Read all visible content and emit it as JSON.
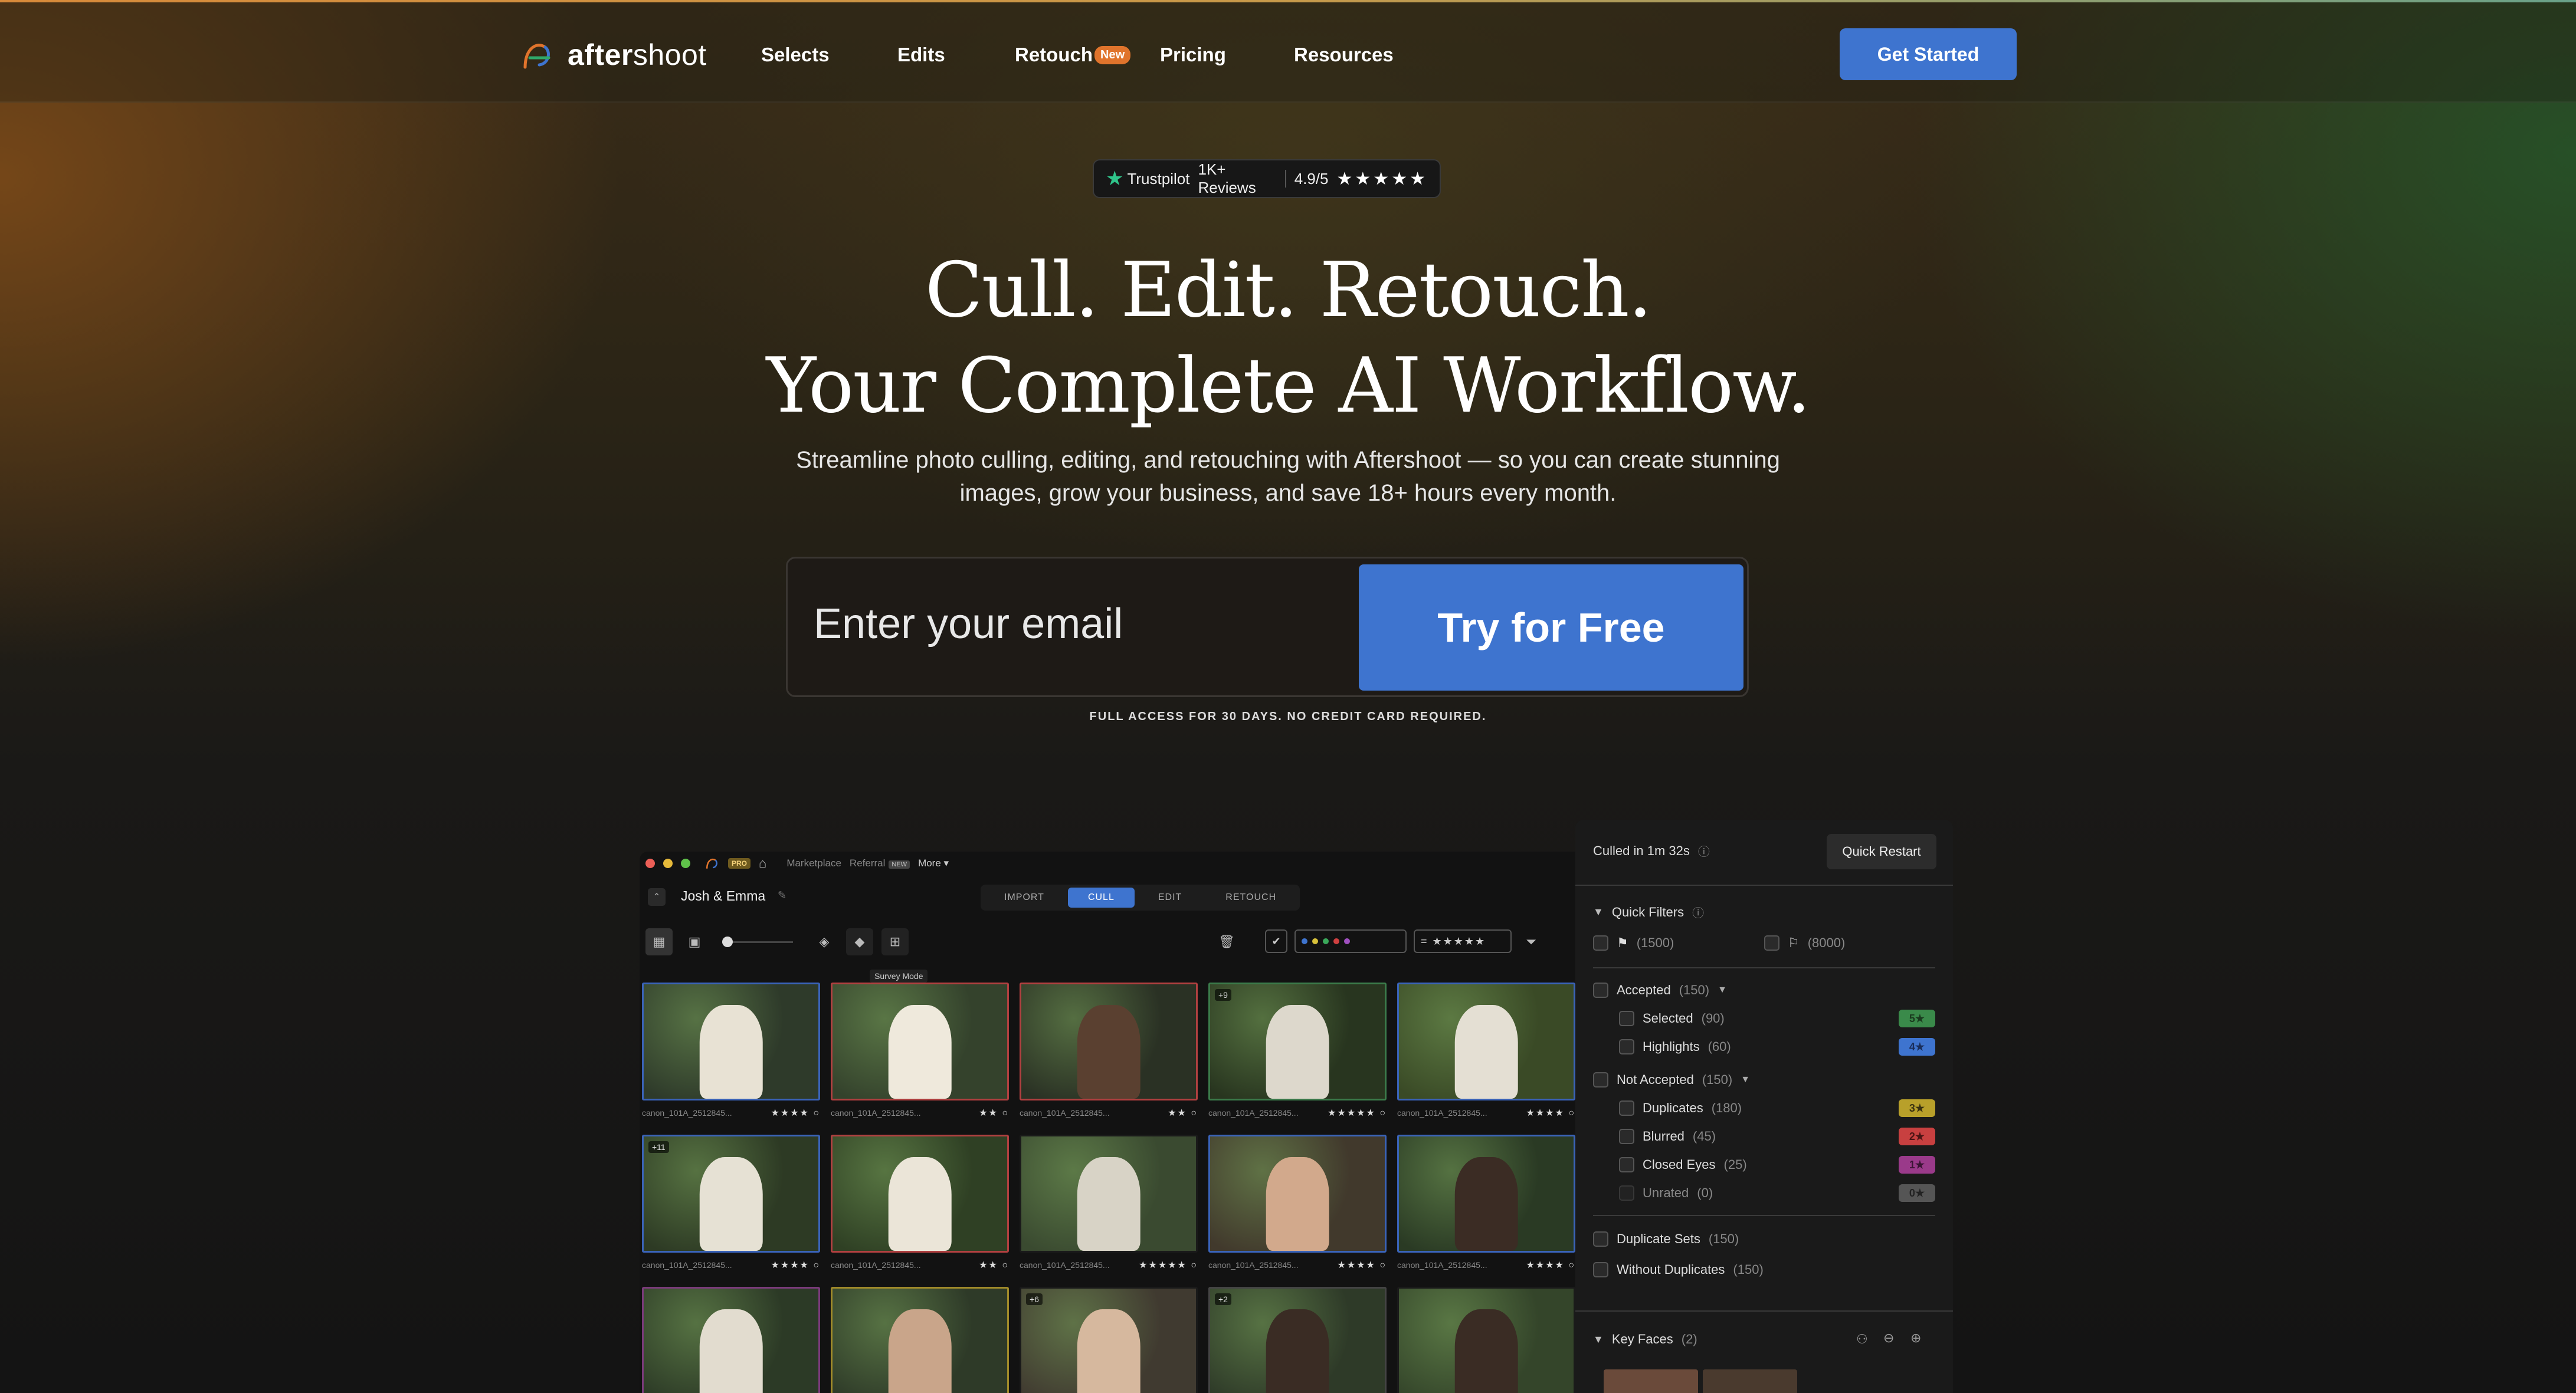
{
  "nav": {
    "logo_bold": "after",
    "logo_rest": "shoot",
    "items": [
      "Selects",
      "Edits",
      "Retouch",
      "Pricing",
      "Resources"
    ],
    "retouch_badge": "New",
    "cta": "Get Started"
  },
  "trustpilot": {
    "brand": "Trustpilot",
    "reviews": "1K+ Reviews",
    "rating": "4.9/5",
    "stars": "★★★★★"
  },
  "hero": {
    "title_line1": "Cull. Edit. Retouch.",
    "title_line2": "Your Complete AI Workflow.",
    "subtitle": "Streamline photo culling, editing, and retouching with Aftershoot — so you can create stunning images, grow your business, and save 18+ hours every month.",
    "email_placeholder": "Enter your email",
    "cta": "Try for Free",
    "note": "FULL ACCESS FOR 30 DAYS. NO CREDIT CARD REQUIRED."
  },
  "app": {
    "pro": "PRO",
    "menu": [
      "Marketplace",
      "Referral",
      "More"
    ],
    "referral_badge": "NEW",
    "project": "Josh & Emma",
    "tabs": [
      "IMPORT",
      "CULL",
      "EDIT",
      "RETOUCH"
    ],
    "active_tab": "CULL",
    "tooltip": "Survey Mode",
    "thumbs": [
      {
        "name": "canon_101A_2512845...",
        "stars": "★★★★",
        "border": "#3a63b8",
        "bg": "#2e3a2a",
        "fig": "#e8e2d4",
        "badge": ""
      },
      {
        "name": "canon_101A_2512845...",
        "stars": "★★",
        "border": "#b04040",
        "bg": "#34422c",
        "fig": "#efe9dc",
        "badge": ""
      },
      {
        "name": "canon_101A_2512845...",
        "stars": "★★",
        "border": "#b04040",
        "bg": "#2a3124",
        "fig": "#5a4030",
        "badge": ""
      },
      {
        "name": "canon_101A_2512845...",
        "stars": "★★★★★",
        "border": "#3b7a4a",
        "bg": "#28351f",
        "fig": "#ddd8cc",
        "badge": "+9"
      },
      {
        "name": "canon_101A_2512845...",
        "stars": "★★★★",
        "border": "#3a63b8",
        "bg": "#3a4a26",
        "fig": "#e4dfd3",
        "badge": ""
      },
      {
        "name": "canon_101A_2512845...",
        "stars": "★★★★",
        "border": "#3a63b8",
        "bg": "#2d3a24",
        "fig": "#e6e1d4",
        "badge": "+11"
      },
      {
        "name": "canon_101A_2512845...",
        "stars": "★★",
        "border": "#b04040",
        "bg": "#2f4024",
        "fig": "#ebe5d8",
        "badge": ""
      },
      {
        "name": "canon_101A_2512845...",
        "stars": "★★★★★",
        "border": "#1a1a1a",
        "bg": "#3a4a30",
        "fig": "#d8d3c6",
        "badge": ""
      },
      {
        "name": "canon_101A_2512845...",
        "stars": "★★★★",
        "border": "#3a63b8",
        "bg": "#41392c",
        "fig": "#d2a98c",
        "badge": ""
      },
      {
        "name": "canon_101A_2512845...",
        "stars": "★★★★",
        "border": "#3a63b8",
        "bg": "#2a3a24",
        "fig": "#3b2c24",
        "badge": ""
      },
      {
        "name": "",
        "stars": "",
        "border": "#7a3a7a",
        "bg": "#2c3a26",
        "fig": "#e2dccf",
        "badge": ""
      },
      {
        "name": "",
        "stars": "",
        "border": "#a08a2a",
        "bg": "#2e3a28",
        "fig": "#c9a58a",
        "badge": ""
      },
      {
        "name": "",
        "stars": "",
        "border": "#1a1a1a",
        "bg": "#403a30",
        "fig": "#d6b89e",
        "badge": "+6"
      },
      {
        "name": "",
        "stars": "",
        "border": "#444444",
        "bg": "#2e3a28",
        "fig": "#3a2c24",
        "badge": "+2"
      },
      {
        "name": "",
        "stars": "",
        "border": "#1a1a1a",
        "bg": "#34452a",
        "fig": "#3a2c24",
        "badge": ""
      }
    ]
  },
  "panel": {
    "culled": "Culled in 1m 32s",
    "restart": "Quick Restart",
    "quick_filters": "Quick Filters",
    "flag1": "(1500)",
    "flag2": "(8000)",
    "accepted": "Accepted",
    "accepted_cnt": "(150)",
    "selected": "Selected",
    "selected_cnt": "(90)",
    "selected_tag": "5★",
    "highlights": "Highlights",
    "highlights_cnt": "(60)",
    "highlights_tag": "4★",
    "not_accepted": "Not Accepted",
    "not_accepted_cnt": "(150)",
    "duplicates": "Duplicates",
    "duplicates_cnt": "(180)",
    "duplicates_tag": "3★",
    "blurred": "Blurred",
    "blurred_cnt": "(45)",
    "blurred_tag": "2★",
    "closed_eyes": "Closed Eyes",
    "closed_eyes_cnt": "(25)",
    "closed_eyes_tag": "1★",
    "unrated": "Unrated",
    "unrated_cnt": "(0)",
    "unrated_tag": "0★",
    "dup_sets": "Duplicate Sets",
    "dup_sets_cnt": "(150)",
    "without_dups": "Without Duplicates",
    "without_dups_cnt": "(150)",
    "key_faces": "Key Faces",
    "key_faces_cnt": "(2)"
  }
}
